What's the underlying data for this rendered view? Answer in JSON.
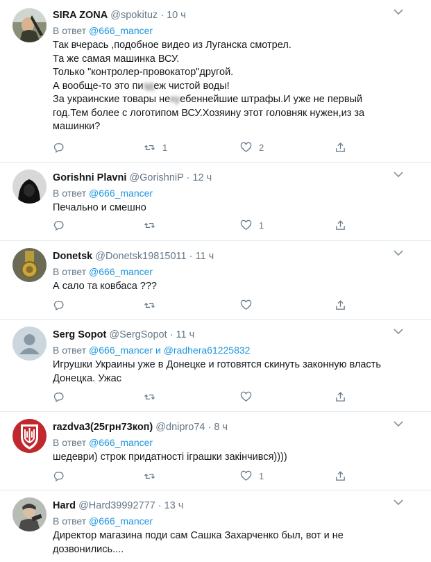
{
  "labels": {
    "in_reply_to": "В ответ",
    "and": "и",
    "dot": "·"
  },
  "colors": {
    "link": "#1b95e0",
    "muted": "#657786",
    "text": "#14171a",
    "divider": "#e1e8ed"
  },
  "tweets": [
    {
      "name": "SIRA ZONA",
      "handle": "@spokituz",
      "time": "10 ч",
      "reply_to": [
        "@666_mancer"
      ],
      "body_a": "Так вчерась ,подобное видео из Луганска смотрел.\nТа же самая машинка ВСУ.\nТолько \"контролер-провокатор\"другой.\nА вообще-то это пи",
      "body_blur_1": "зд",
      "body_b": "еж чистой воды!\nЗа украинские товары не",
      "body_blur_2": "ху",
      "body_c": "ебеннейшие штрафы.И уже не первый\nгод.Тем более с логотипом ВСУ.Хозяину этот головняк нужен,из за\nмашинки?",
      "retweets": "1",
      "likes": "2",
      "avatar_icon": "person-photo-icon"
    },
    {
      "name": "Gorishni Plavni",
      "handle": "@GorishniP",
      "time": "12 ч",
      "reply_to": [
        "@666_mancer"
      ],
      "body": "Печально  и смешно",
      "retweets": "",
      "likes": "1",
      "avatar_icon": "hooded-figure-icon"
    },
    {
      "name": "Donetsk",
      "handle": "@Donetsk19815011",
      "time": "11 ч",
      "reply_to": [
        "@666_mancer"
      ],
      "body": "А сало та ковбаса  ???",
      "retweets": "",
      "likes": "",
      "avatar_icon": "medal-icon"
    },
    {
      "name": "Serg Sopot",
      "handle": "@SergSopot",
      "time": "11 ч",
      "reply_to": [
        "@666_mancer",
        "@radhera61225832"
      ],
      "body": "Игрушки Украины уже в Донецке и готовятся скинуть законную власть\nДонецка.  Ужас",
      "retweets": "",
      "likes": "",
      "avatar_icon": "default-profile-icon"
    },
    {
      "name": "razdva3(25грн73коп)",
      "handle": "@dnipro74",
      "time": "8 ч",
      "reply_to": [
        "@666_mancer"
      ],
      "body": "шедеври) строк придатності іграшки закінчився))))",
      "retweets": "",
      "likes": "1",
      "avatar_icon": "trident-shield-icon"
    },
    {
      "name": "Hard",
      "handle": "@Hard39992777",
      "time": "13 ч",
      "reply_to": [
        "@666_mancer"
      ],
      "body": "Директор магазина поди сам Сашка Захарченко был, вот и не\nдозвонились....",
      "retweets": "",
      "likes": "",
      "avatar_icon": "person-photo-icon"
    }
  ]
}
